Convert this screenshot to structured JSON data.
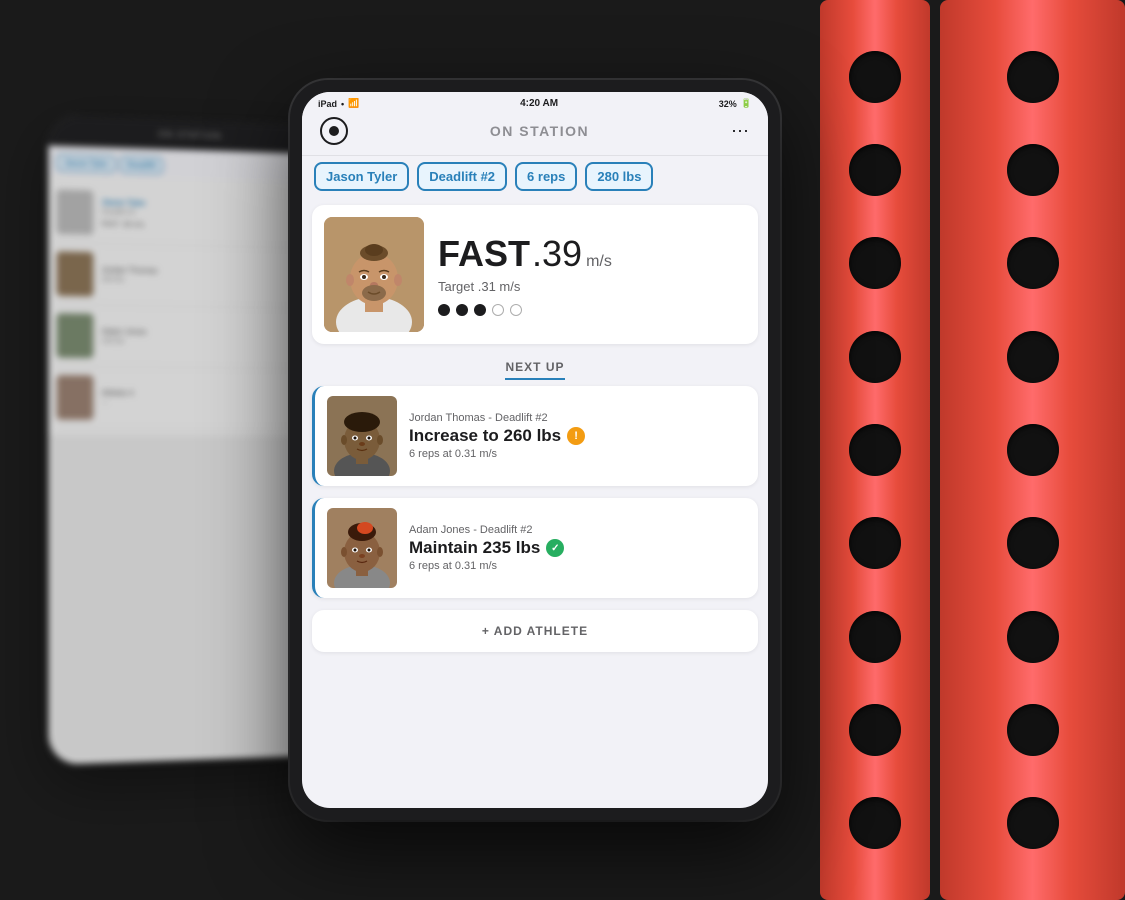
{
  "background": {
    "color": "#1a1a1a"
  },
  "rack": {
    "holes_count": 9,
    "color": "#e74c3c"
  },
  "tablet_bg": {
    "visible": true,
    "athletes": [
      {
        "name": "Jason Tyler",
        "detail": "Deadlift"
      },
      {
        "name": "Athlete 2",
        "detail": ""
      },
      {
        "name": "Athlete 3",
        "detail": ""
      },
      {
        "name": "Athlete 4",
        "detail": ""
      }
    ]
  },
  "tablet_main": {
    "status_bar": {
      "device": "iPad",
      "wifi": "WiFi",
      "time": "4:20 AM",
      "battery": "32%"
    },
    "header": {
      "title": "ON STATION",
      "menu_dots": "..."
    },
    "athlete_bar": {
      "name": "Jason Tyler",
      "exercise": "Deadlift #2",
      "reps": "6 reps",
      "weight": "280 lbs"
    },
    "current_session": {
      "velocity_label": "FAST",
      "velocity_value": ".39",
      "velocity_unit": "m/s",
      "target_label": "Target .31 m/s",
      "dots_filled": 3,
      "dots_total": 5
    },
    "next_up": {
      "section_title": "NEXT UP",
      "athletes": [
        {
          "name": "Jordan Thomas - Deadlift #2",
          "action": "Increase to 260 lbs",
          "badge": "warning",
          "detail": "6 reps at 0.31 m/s"
        },
        {
          "name": "Adam Jones - Deadlift #2",
          "action": "Maintain 235 lbs",
          "badge": "success",
          "detail": "6 reps at 0.31 m/s"
        }
      ]
    },
    "add_athlete": {
      "label": "+ ADD ATHLETE"
    }
  }
}
